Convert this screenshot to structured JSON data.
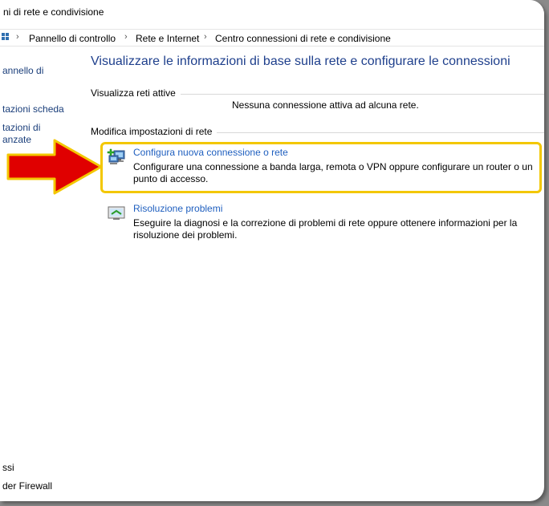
{
  "window": {
    "title": "ni di rete e condivisione"
  },
  "breadcrumb": {
    "items": [
      "Pannello di controllo",
      "Rete e Internet",
      "Centro connessioni di rete e condivisione"
    ]
  },
  "sidebar": {
    "items": [
      {
        "label": "annello di"
      },
      {
        "label": "tazioni scheda"
      },
      {
        "label": "tazioni di"
      },
      {
        "label": "anzate"
      }
    ],
    "bottom_items": [
      {
        "label": "ssi"
      },
      {
        "label": "der Firewall"
      }
    ]
  },
  "main": {
    "heading": "Visualizzare le informazioni di base sulla rete e configurare le connessioni",
    "active_networks": {
      "label": "Visualizza reti attive",
      "empty_text": "Nessuna connessione attiva ad alcuna rete."
    },
    "change_settings": {
      "label": "Modifica impostazioni di rete",
      "tasks": [
        {
          "icon": "network-setup-icon",
          "link": "Configura nuova connessione o rete",
          "description": "Configurare una connessione a banda larga, remota o VPN oppure configurare un router o un punto di accesso."
        },
        {
          "icon": "troubleshoot-icon",
          "link": "Risoluzione problemi",
          "description": "Eseguire la diagnosi e la correzione di problemi di rete oppure ottenere informazioni per la risoluzione dei problemi."
        }
      ]
    }
  },
  "annotation": {
    "arrow_color": "#e00000",
    "arrow_outline_color": "#f3c700",
    "highlight_color": "#f3c700"
  },
  "colors": {
    "heading": "#1e3f8c",
    "link": "#1f5fbf"
  }
}
